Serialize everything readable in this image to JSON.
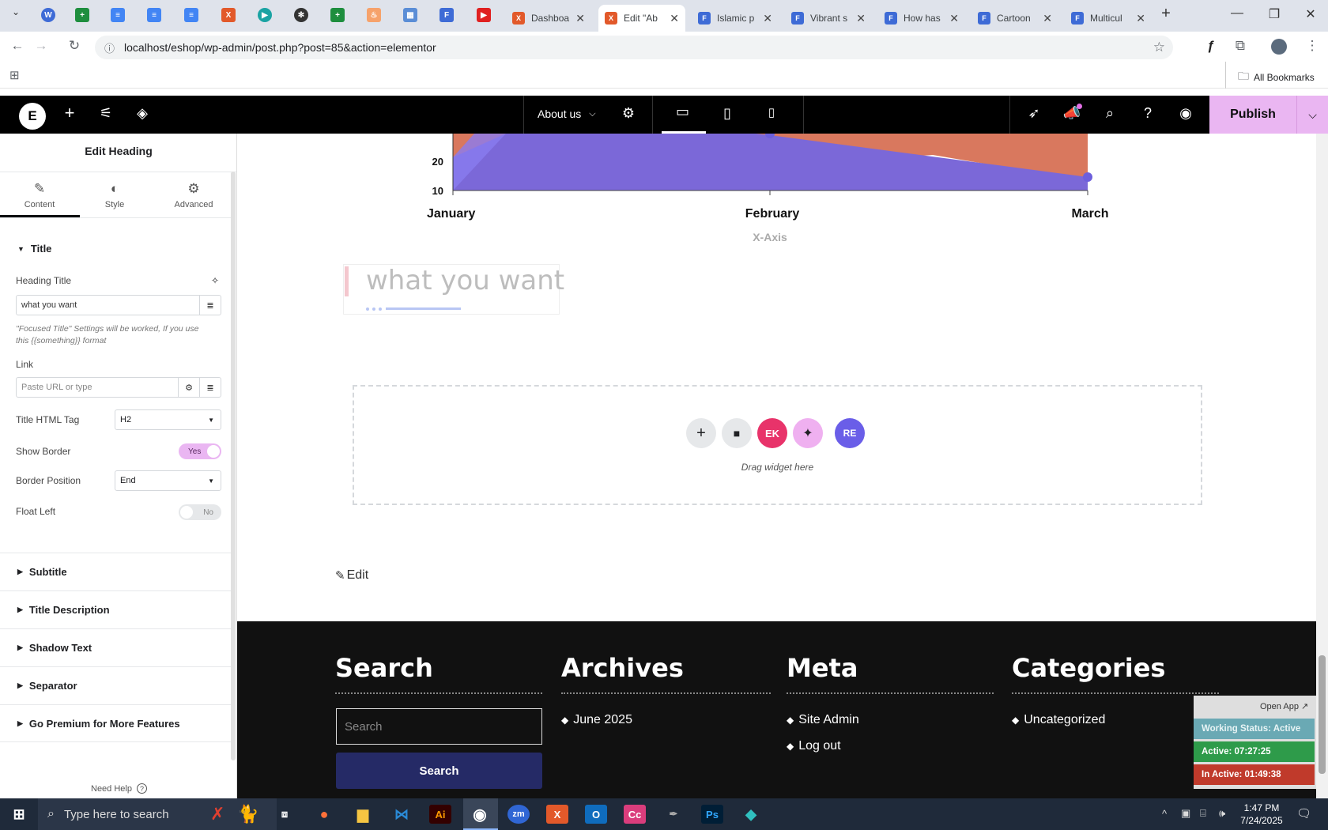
{
  "browser": {
    "tabs": [
      {
        "title": "Dashboa",
        "active": false
      },
      {
        "title": "Edit \"Ab",
        "active": true
      },
      {
        "title": "Islamic p",
        "active": false
      },
      {
        "title": "Vibrant s",
        "active": false
      },
      {
        "title": "How has",
        "active": false
      },
      {
        "title": "Cartoon",
        "active": false
      },
      {
        "title": "Multicul",
        "active": false
      }
    ],
    "url": "localhost/eshop/wp-admin/post.php?post=85&action=elementor",
    "bookmarks_label": "All Bookmarks"
  },
  "editor": {
    "page_name": "About us",
    "publish_label": "Publish"
  },
  "panel": {
    "title": "Edit Heading",
    "tabs": [
      {
        "label": "Content",
        "icon": "pencil-icon"
      },
      {
        "label": "Style",
        "icon": "contrast-icon"
      },
      {
        "label": "Advanced",
        "icon": "gear-icon"
      }
    ],
    "section_title": "Title",
    "heading_title_label": "Heading Title",
    "heading_title_value": "what you want",
    "focused_note": "\"Focused Title\" Settings will be worked, If you use this {{something}} format",
    "link_label": "Link",
    "link_placeholder": "Paste URL or type",
    "html_tag_label": "Title HTML Tag",
    "html_tag_value": "H2",
    "show_border_label": "Show Border",
    "show_border_value": "Yes",
    "border_position_label": "Border Position",
    "border_position_value": "End",
    "float_left_label": "Float Left",
    "float_left_value": "No",
    "sections": [
      "Subtitle",
      "Title Description",
      "Shadow Text",
      "Separator",
      "Go Premium for More Features"
    ],
    "need_help": "Need Help"
  },
  "chart_data": {
    "type": "area",
    "categories": [
      "January",
      "February",
      "March"
    ],
    "y_ticks_visible": [
      "20",
      "10"
    ],
    "xlabel": "X-Axis",
    "colors": [
      "#7b68d8",
      "#d9785e"
    ]
  },
  "canvas": {
    "heading_preview": "what you want",
    "drag_text": "Drag widget here",
    "edit_link": "Edit"
  },
  "footer": {
    "search_heading": "Search",
    "search_placeholder": "Search",
    "search_button": "Search",
    "archives_heading": "Archives",
    "archives_items": [
      "June 2025"
    ],
    "meta_heading": "Meta",
    "meta_items": [
      "Site Admin",
      "Log out"
    ],
    "categories_heading": "Categories",
    "categories_items": [
      "Uncategorized"
    ]
  },
  "overlay": {
    "open_app": "Open App",
    "working_status": "Working Status: Active",
    "active": "Active: 07:27:25",
    "inactive": "In Active: 01:49:38"
  },
  "taskbar": {
    "search_placeholder": "Type here to search",
    "time": "1:47 PM",
    "date": "7/24/2025"
  }
}
